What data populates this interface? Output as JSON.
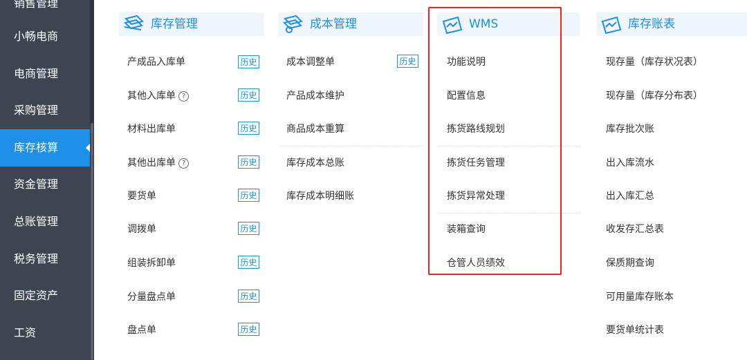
{
  "sidebar": {
    "items": [
      {
        "label": "销售管理"
      },
      {
        "label": "小畅电商"
      },
      {
        "label": "电商管理"
      },
      {
        "label": "采购管理"
      },
      {
        "label": "库存核算"
      },
      {
        "label": "资金管理"
      },
      {
        "label": "总账管理"
      },
      {
        "label": "税务管理"
      },
      {
        "label": "固定资产"
      },
      {
        "label": "工资"
      }
    ],
    "active_index": 4
  },
  "columns": [
    {
      "title": "库存管理",
      "icon": "inventory-icon",
      "items": [
        {
          "label": "产成品入库单",
          "badge": "历史"
        },
        {
          "label": "其他入库单",
          "help": "?",
          "badge": "历史"
        },
        {
          "label": "材料出库单",
          "badge": "历史"
        },
        {
          "label": "其他出库单",
          "help": "?",
          "badge": "历史"
        },
        {
          "label": "要货单",
          "badge": "历史"
        },
        {
          "label": "调拨单",
          "badge": "历史"
        },
        {
          "label": "组装拆卸单",
          "badge": "历史"
        },
        {
          "label": "分量盘点单",
          "badge": "历史"
        },
        {
          "label": "盘点单",
          "badge": "历史"
        }
      ]
    },
    {
      "title": "成本管理",
      "icon": "cost-icon",
      "items": [
        {
          "label": "成本调整单",
          "badge": "历史"
        },
        {
          "label": "产品成本维护"
        },
        {
          "label": "商品成本重算"
        },
        {
          "label": "库存成本总账"
        },
        {
          "label": "库存成本明细账"
        }
      ]
    },
    {
      "title": "WMS",
      "icon": "wms-icon",
      "items": [
        {
          "label": "功能说明"
        },
        {
          "label": "配置信息"
        },
        {
          "label": "拣货路线规划"
        },
        {
          "label": "拣货任务管理"
        },
        {
          "label": "拣货异常处理"
        },
        {
          "label": "装箱查询"
        },
        {
          "label": "仓管人员绩效"
        }
      ]
    },
    {
      "title": "库存账表",
      "icon": "ledger-icon",
      "items": [
        {
          "label": "现存量（库存状况表）"
        },
        {
          "label": "现存量（库存分布表）"
        },
        {
          "label": "库存批次账"
        },
        {
          "label": "出入库流水"
        },
        {
          "label": "出入库汇总"
        },
        {
          "label": "收发存汇总表"
        },
        {
          "label": "保质期查询"
        },
        {
          "label": "可用量库存账本"
        },
        {
          "label": "要货单统计表"
        }
      ]
    }
  ],
  "colors": {
    "sidebar_bg": "#3e4451",
    "active_bg": "#1e90e8",
    "accent": "#1e90e8",
    "header_bg": "#eef5fc",
    "highlight": "#ee2222"
  }
}
